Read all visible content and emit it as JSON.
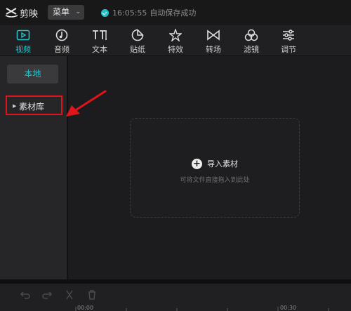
{
  "titlebar": {
    "app_name": "剪映",
    "menu_label": "菜单",
    "save_time": "16:05:55",
    "save_status": "自动保存成功"
  },
  "toolbar": {
    "items": [
      {
        "label": "视频",
        "icon": "video-icon",
        "active": true
      },
      {
        "label": "音频",
        "icon": "audio-icon"
      },
      {
        "label": "文本",
        "icon": "text-icon"
      },
      {
        "label": "贴纸",
        "icon": "sticker-icon"
      },
      {
        "label": "特效",
        "icon": "effects-icon"
      },
      {
        "label": "转场",
        "icon": "transition-icon"
      },
      {
        "label": "滤镜",
        "icon": "filter-icon"
      },
      {
        "label": "调节",
        "icon": "adjust-icon"
      }
    ]
  },
  "left_panel": {
    "local_label": "本地",
    "library_label": "素材库"
  },
  "main": {
    "import_label": "导入素材",
    "hint": "可将文件直接拖入到此处"
  },
  "timeline": {
    "ruler_labels": [
      "00:00",
      "00:30"
    ]
  },
  "colors": {
    "accent": "#22c3cc",
    "highlight_border": "#e0141b",
    "arrow": "#e0141b"
  }
}
